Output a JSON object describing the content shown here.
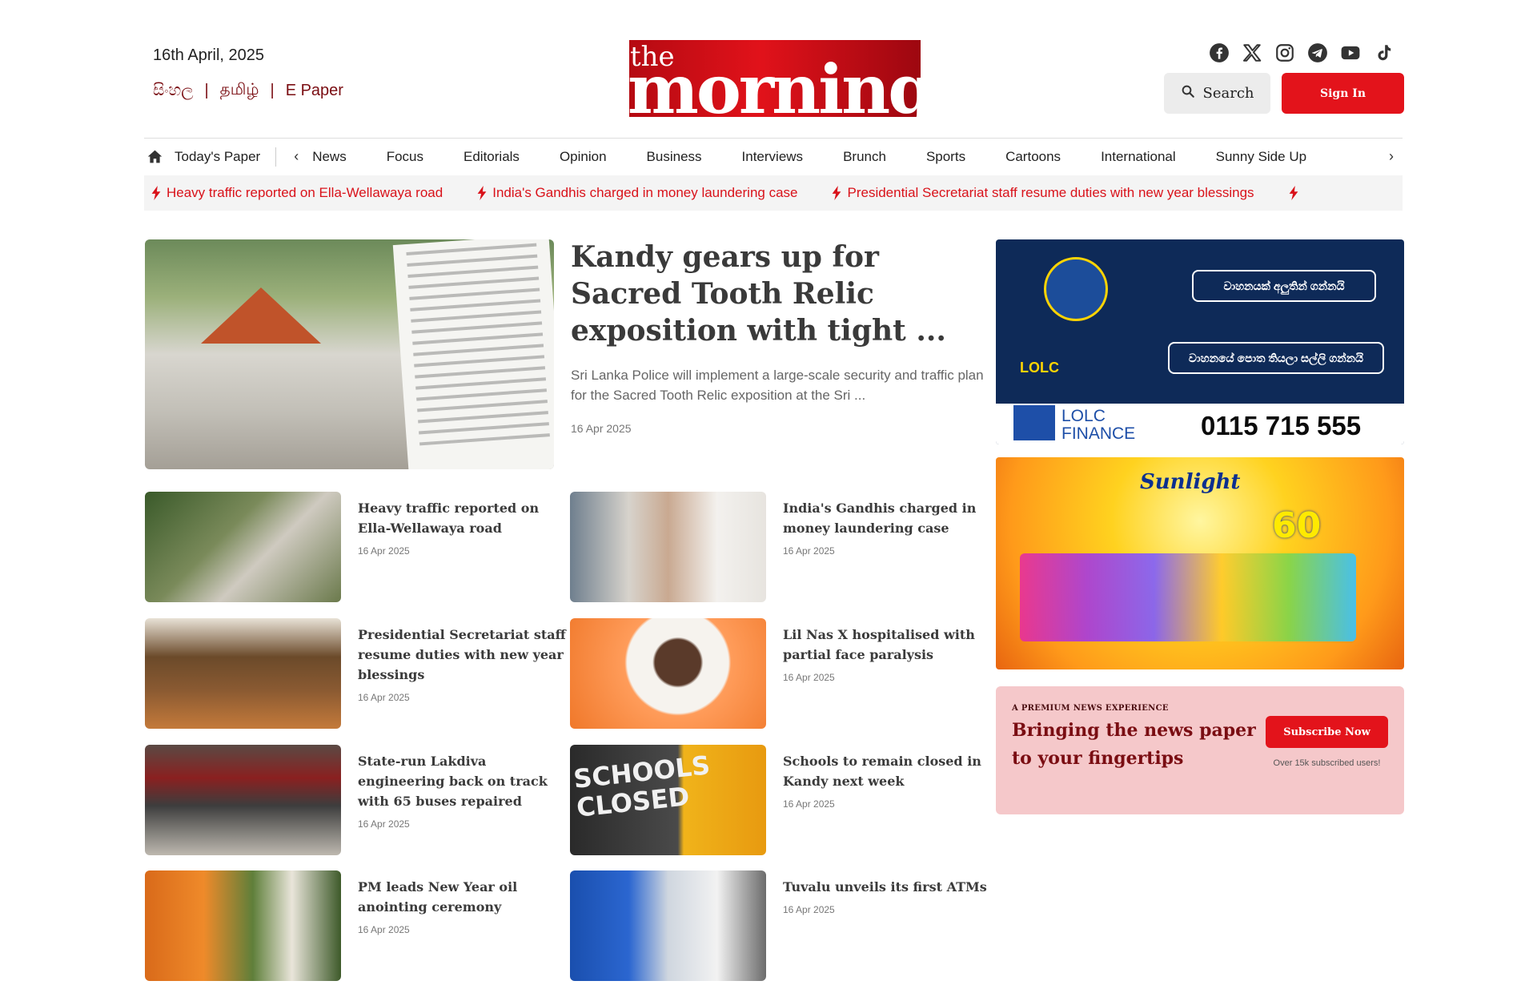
{
  "header": {
    "date": "16th April, 2025",
    "languages": [
      {
        "label": "සිංහල"
      },
      {
        "label": "தமிழ்"
      },
      {
        "label": "E Paper"
      }
    ],
    "language_separator": "|",
    "logo": {
      "line1": "the",
      "line2": "morning"
    },
    "social_icons": [
      "facebook-icon",
      "x-icon",
      "instagram-icon",
      "telegram-icon",
      "youtube-icon",
      "tiktok-icon"
    ],
    "search_label": "Search",
    "signin_label": "Sign In"
  },
  "nav": {
    "home_label": "Today's Paper",
    "items": [
      "News",
      "Focus",
      "Editorials",
      "Opinion",
      "Business",
      "Interviews",
      "Brunch",
      "Sports",
      "Cartoons",
      "International",
      "Sunny Side Up"
    ]
  },
  "ticker": [
    "Heavy traffic reported on Ella-Wellawaya road",
    "India's Gandhis charged in money laundering case",
    "Presidential Secretariat staff resume duties with new year blessings"
  ],
  "lead": {
    "title": "Kandy gears up for Sacred Tooth Relic exposition with tight ...",
    "summary": "Sri Lanka Police will implement a large-scale security and traffic plan for the Sacred Tooth Relic exposition at the Sri ...",
    "date": "16 Apr 2025"
  },
  "articles": [
    {
      "title": "Heavy traffic reported on Ella-Wellawaya road",
      "date": "16 Apr 2025"
    },
    {
      "title": "India's Gandhis charged in money laundering case",
      "date": "16 Apr 2025"
    },
    {
      "title": "Presidential Secretariat staff resume duties with new year blessings",
      "date": "16 Apr 2025"
    },
    {
      "title": "Lil Nas X hospitalised with partial face paralysis",
      "date": "16 Apr 2025"
    },
    {
      "title": "State-run Lakdiva engineering back on track with 65 buses repaired",
      "date": "16 Apr 2025"
    },
    {
      "title": "Schools to remain closed in Kandy next week",
      "date": "16 Apr 2025"
    },
    {
      "title": "PM leads New Year oil anointing ceremony",
      "date": "16 Apr 2025"
    },
    {
      "title": "Tuvalu unveils its first ATMs",
      "date": "16 Apr 2025"
    }
  ],
  "ads": {
    "lolc": {
      "pill1": "වාහනයක් අලුතින් ගන්නයි",
      "pill2": "වාහනයේ පොත තියලා සල්ලි ගන්නයි",
      "brand": "LOLC",
      "brand_name": "LOLC FINANCE",
      "phone": "0115 715 555"
    },
    "sunlight": {
      "title": "Sunlight",
      "number": "60"
    }
  },
  "promo": {
    "kicker": "A PREMIUM NEWS EXPERIENCE",
    "headline": "Bringing the news paper to your fingertips",
    "button": "Subscribe Now",
    "note": "Over 15k subscribed users!"
  },
  "colors": {
    "brand_red": "#e3131b",
    "dark_red": "#7a0d12",
    "ticker_red": "#d9121a",
    "promo_bg": "#f5c8ca"
  }
}
